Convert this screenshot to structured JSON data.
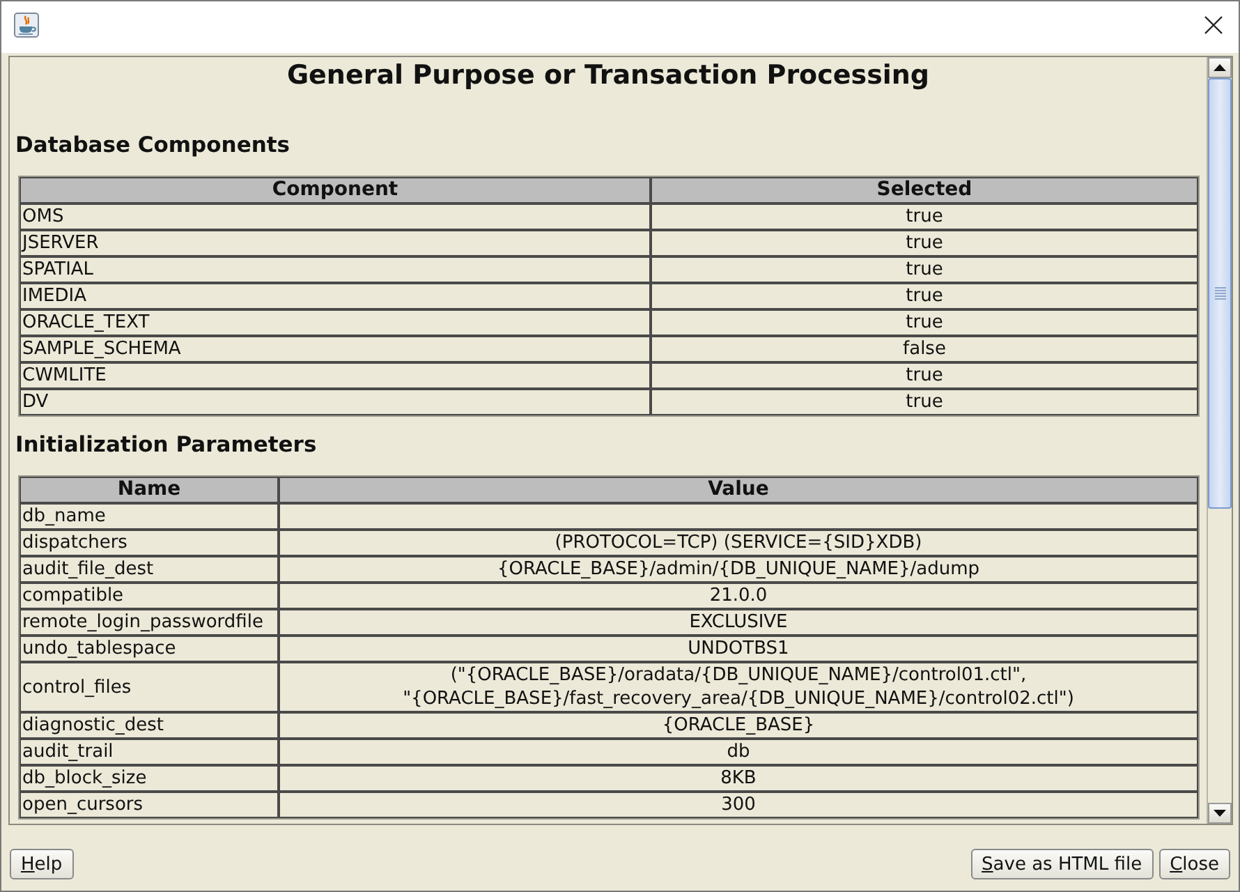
{
  "report": {
    "title": "General Purpose or Transaction Processing",
    "sections": [
      {
        "heading": "Database Components",
        "table": {
          "columns": [
            "Component",
            "Selected"
          ],
          "rows": [
            [
              "OMS",
              "true"
            ],
            [
              "JSERVER",
              "true"
            ],
            [
              "SPATIAL",
              "true"
            ],
            [
              "IMEDIA",
              "true"
            ],
            [
              "ORACLE_TEXT",
              "true"
            ],
            [
              "SAMPLE_SCHEMA",
              "false"
            ],
            [
              "CWMLITE",
              "true"
            ],
            [
              "DV",
              "true"
            ]
          ]
        }
      },
      {
        "heading": "Initialization Parameters",
        "table": {
          "columns": [
            "Name",
            "Value"
          ],
          "rows": [
            [
              "db_name"
            ],
            [
              "dispatchers",
              "(PROTOCOL=TCP) (SERVICE={SID}XDB)"
            ],
            [
              "audit_file_dest",
              "{ORACLE_BASE}/admin/{DB_UNIQUE_NAME}/adump"
            ],
            [
              "compatible",
              "21.0.0"
            ],
            [
              "remote_login_passwordfile",
              "EXCLUSIVE"
            ],
            [
              "undo_tablespace",
              "UNDOTBS1"
            ],
            [
              "control_files",
              "(\"{ORACLE_BASE}/oradata/{DB_UNIQUE_NAME}/control01.ctl\",\n\"{ORACLE_BASE}/fast_recovery_area/{DB_UNIQUE_NAME}/control02.ctl\")"
            ],
            [
              "diagnostic_dest",
              "{ORACLE_BASE}"
            ],
            [
              "audit_trail",
              "db"
            ],
            [
              "db_block_size",
              "8KB"
            ],
            [
              "open_cursors",
              "300"
            ]
          ]
        }
      }
    ]
  },
  "buttons": [
    {
      "label": "Help"
    },
    {
      "label": "Save as HTML file"
    },
    {
      "label": "Close"
    }
  ]
}
